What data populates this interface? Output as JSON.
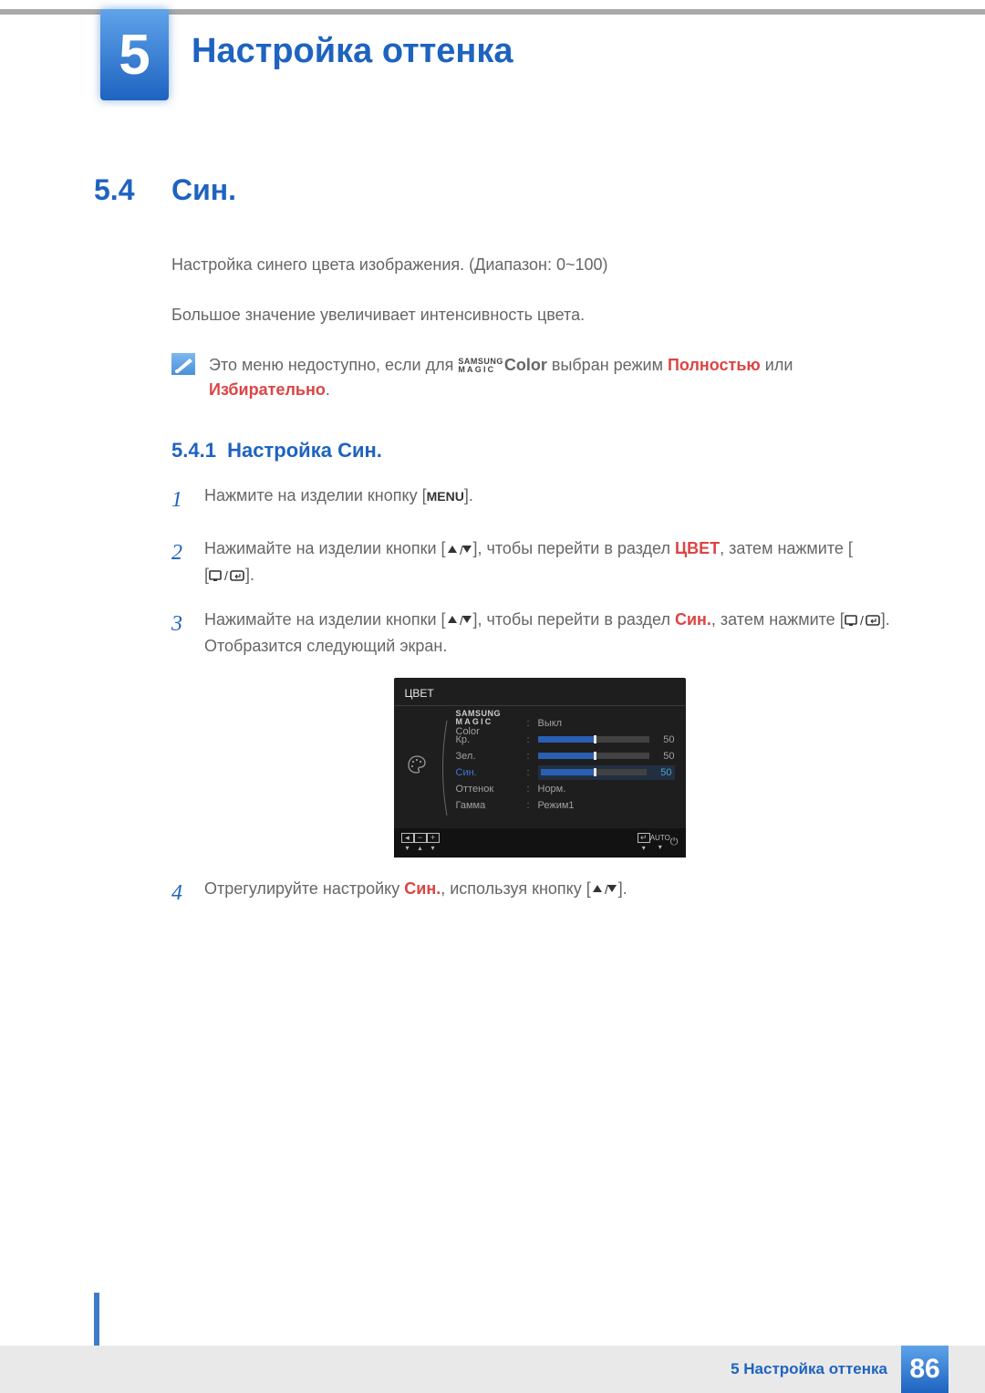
{
  "chapter": {
    "number": "5",
    "title": "Настройка оттенка"
  },
  "section": {
    "number": "5.4",
    "title": "Син."
  },
  "body": {
    "p1": "Настройка синего цвета изображения. (Диапазон: 0~100)",
    "p2": "Большое значение увеличивает интенсивность цвета."
  },
  "note": {
    "pre": "Это меню недоступно, если для ",
    "magic_samsung": "SAMSUNG",
    "magic_magic": "MAGIC",
    "magic_color": "Color",
    "mid": " выбран режим ",
    "full": "Полностью",
    "or": " или ",
    "selective": "Избирательно",
    "end": "."
  },
  "subsection": {
    "number": "5.4.1",
    "title": "Настройка Син."
  },
  "steps": {
    "s1": {
      "pre": "Нажмите на изделии кнопку [",
      "menu": "MENU",
      "post": "]."
    },
    "s2": {
      "pre": "Нажимайте на изделии кнопки [",
      "mid1": "], чтобы перейти в раздел ",
      "target": "ЦВЕТ",
      "mid2": ", затем нажмите [",
      "post": "]."
    },
    "s3": {
      "pre": "Нажимайте на изделии кнопки [",
      "mid1": "], чтобы перейти в раздел ",
      "target": "Син.",
      "mid2": ", затем нажмите [",
      "post": "]. Отобразится следующий экран."
    },
    "s4": {
      "pre": "Отрегулируйте настройку ",
      "target": "Син.",
      "mid": ", используя кнопку [",
      "post": "]."
    }
  },
  "osd": {
    "title": "ЦВЕТ",
    "rows": {
      "magic_samsung": "SAMSUNG",
      "magic_magic": "MAGIC",
      "magic_color": "Color",
      "magic_val": "Выкл",
      "red_label": "Кр.",
      "green_label": "Зел.",
      "blue_label": "Син.",
      "tint_label": "Оттенок",
      "tint_val": "Норм.",
      "gamma_label": "Гамма",
      "gamma_val": "Режим1",
      "red_val": "50",
      "green_val": "50",
      "blue_val": "50"
    },
    "controls": {
      "auto": "AUTO"
    }
  },
  "footer": {
    "text": "5 Настройка оттенка",
    "page": "86"
  }
}
